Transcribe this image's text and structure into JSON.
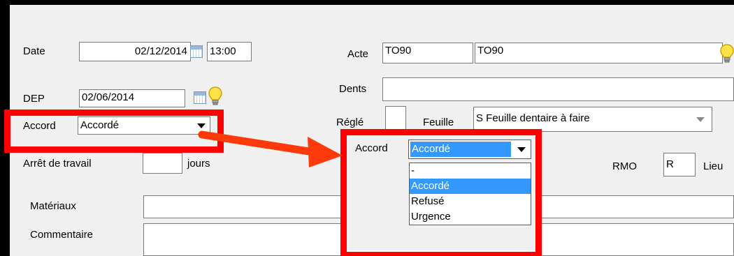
{
  "form": {
    "date": {
      "label": "Date",
      "value": "02/12/2014",
      "time": "13:00"
    },
    "dep": {
      "label": "DEP",
      "value": "02/06/2014"
    },
    "accord": {
      "label": "Accord",
      "value": "Accordé"
    },
    "arret": {
      "label": "Arrêt de travail",
      "value": "",
      "unit": "jours"
    },
    "materiaux": {
      "label": "Matériaux",
      "value": ""
    },
    "commentaire": {
      "label": "Commentaire",
      "value": ""
    },
    "acte": {
      "label": "Acte",
      "code": "TO90",
      "description": "TO90"
    },
    "dents": {
      "label": "Dents",
      "value": ""
    },
    "regle": {
      "label": "Réglé",
      "value": ""
    },
    "feuille": {
      "label": "Feuille",
      "value": "S Feuille dentaire à faire"
    },
    "rmo": {
      "label": "RMO",
      "value": "R"
    },
    "lieu": {
      "label": "Lieu"
    }
  },
  "zoom": {
    "accord_label": "Accord",
    "selected": "Accordé",
    "options": [
      "-",
      "Accordé",
      "Refusé",
      "Urgence"
    ],
    "selected_index": 1
  },
  "colors": {
    "highlight_box": "#ff0000",
    "arrow": "#ff3a0a",
    "selection": "#3399ff",
    "background": "#000000",
    "panel": "#f0f0f0"
  },
  "icons": {
    "calendar": "calendar-icon",
    "hint": "lightbulb-icon"
  }
}
